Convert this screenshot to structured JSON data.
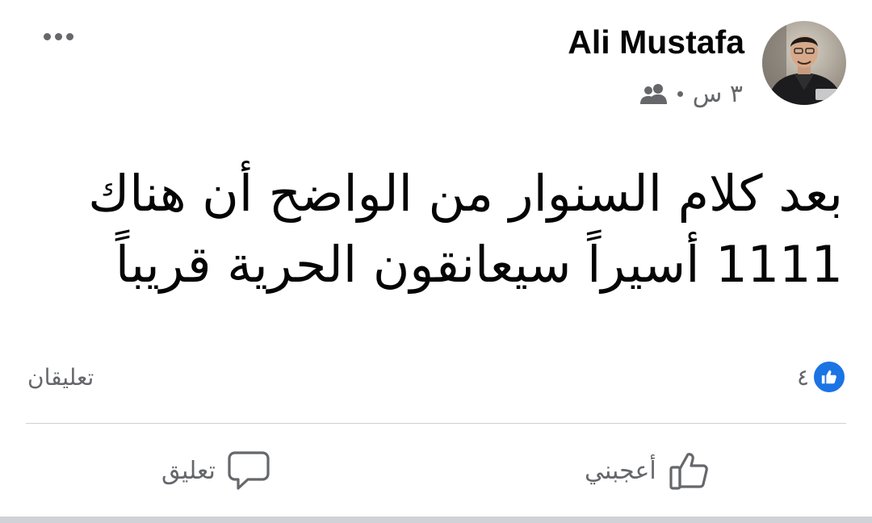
{
  "post": {
    "author": {
      "name": "Ali Mustafa",
      "avatar_icon": "profile-photo"
    },
    "timestamp": "٣ س",
    "audience_icon": "friends-icon",
    "more_icon": "more-options-icon",
    "text_lines": [
      "بعد كلام السنوار من الواضح أن هناك",
      "1111 أسيراً سيعانقون الحرية قريباً"
    ],
    "reactions": {
      "icon": "like-reaction-icon",
      "count": "٤",
      "color": "#1b74e4"
    },
    "comments_count_label": "تعليقان",
    "actions": {
      "like_label": "أعجبني",
      "like_icon": "thumbs-up-outline-icon",
      "comment_label": "تعليق",
      "comment_icon": "speech-bubble-icon"
    }
  },
  "colors": {
    "text_primary": "#050505",
    "text_secondary": "#65676b",
    "divider": "#ced0d4",
    "accent": "#1b74e4"
  }
}
